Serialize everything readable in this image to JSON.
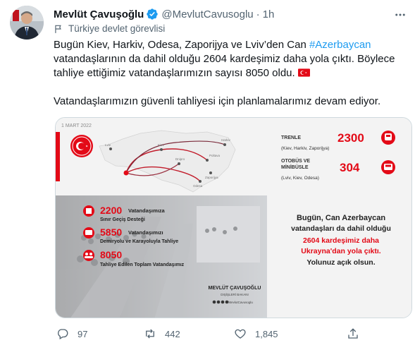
{
  "author": {
    "name": "Mevlüt Çavuşoğlu",
    "handle": "@MevlutCavusoglu",
    "separator": "·",
    "time": "1h",
    "label": "Türkiye devlet görevlisi"
  },
  "tweet": {
    "text_before_hashtag": "Bugün Kiev, Harkiv, Odesa, Zaporijya ve Lviv’den Can ",
    "hashtag": "#Azerbaycan",
    "text_after_hashtag": " vatandaşlarının da dahil olduğu 2604 kardeşimiz daha yola çıktı. Böylece tahliye ettiğimiz vatandaşlarımızın sayısı 8050 oldu.",
    "paragraph2": "Vatandaşlarımızın güvenli tahliyesi için planlamalarımız devam ediyor."
  },
  "infographic": {
    "date": "1 MART 2022",
    "cities": [
      "Lviv",
      "Kiev",
      "Harkiv",
      "Poltava",
      "Odesa",
      "Zaporijya",
      "Dnipro"
    ],
    "trenle_label": "TRENLE",
    "trenle_value": "2300",
    "trenle_cities": "(Kiev, Harkiv, Zaporijya)",
    "otobus_label_1": "OTOBÜS VE",
    "otobus_label_2": "MİNİBÜSLE",
    "otobus_value": "304",
    "otobus_cities": "(Lviv, Kiev, Odesa)",
    "stat1_value": "2200",
    "stat1_text": "Vatandaşımıza",
    "stat1_sub": "Sınır Geçiş Desteği",
    "stat2_value": "5850",
    "stat2_text": "Vatandaşımızı",
    "stat2_sub": "Demiryolu ve Karayoluyla Tahliye",
    "stat3_value": "8050",
    "stat3_sub": "Tahliye Edilen Toplam Vatandaşımız",
    "msg_line1": "Bugün, Can Azerbaycan",
    "msg_line2": "vatandaşları da dahil olduğu",
    "msg_line3": "2604 kardeşimiz daha",
    "msg_line4": "Ukrayna'dan yola çıktı.",
    "msg_line5": "Yolunuz açık olsun.",
    "signature_name": "MEVLÜT ÇAVUŞOĞLU",
    "signature_title": "DIŞİŞLERİ BAKANI",
    "signature_handle": "/MevlutCavusoglu"
  },
  "actions": {
    "replies": "97",
    "retweets": "442",
    "likes": "1,845"
  },
  "colors": {
    "accent": "#1d9bf0",
    "muted": "#536471",
    "red": "#e30a17"
  }
}
